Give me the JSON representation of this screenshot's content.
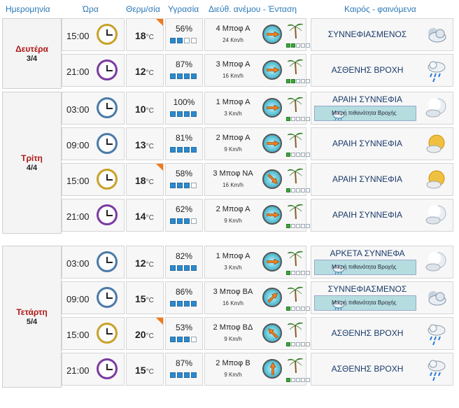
{
  "headers": {
    "date": "Ημερομηνία",
    "hour": "Ώρα",
    "temp": "Θερμ/σία",
    "humidity": "Υγρασία",
    "wind": "Διεύθ. ανέμου - Ένταση",
    "weather": "Καιρός - φαινόμενα"
  },
  "units": {
    "celsius": "°C"
  },
  "days": [
    {
      "name": "Δευτέρα",
      "date": "3/4",
      "rows": [
        {
          "time": "15:00",
          "clock": "pm1",
          "temp": "18",
          "temp_flag": true,
          "humidity": "56%",
          "hum_level": 2,
          "wind_dir": "4 Μποφ Α",
          "wind_speed": "24 Km/h",
          "wind_level": 2,
          "weather": "ΣΥΝΝΕΦΙΑΣΜΕΝΟΣ",
          "rain_note": "",
          "icon": "cloudy-icon"
        },
        {
          "time": "21:00",
          "clock": "pm2",
          "temp": "12",
          "temp_flag": false,
          "humidity": "87%",
          "hum_level": 4,
          "wind_dir": "3 Μποφ Α",
          "wind_speed": "16 Km/h",
          "wind_level": 2,
          "weather": "ΑΣΘΕΝΗΣ ΒΡΟΧΗ",
          "rain_note": "",
          "icon": "light-rain-icon"
        }
      ]
    },
    {
      "name": "Τρίτη",
      "date": "4/4",
      "rows": [
        {
          "time": "03:00",
          "clock": "am",
          "temp": "10",
          "temp_flag": false,
          "humidity": "100%",
          "hum_level": 4,
          "wind_dir": "1 Μποφ Α",
          "wind_speed": "3 Km/h",
          "wind_level": 1,
          "weather": "ΑΡΑΙΗ ΣΥΝΝΕΦΙΑ",
          "rain_note": "Μικρή πιθανότητα Βροχής",
          "icon": "moon-cloud-icon"
        },
        {
          "time": "09:00",
          "clock": "am",
          "temp": "13",
          "temp_flag": false,
          "humidity": "81%",
          "hum_level": 4,
          "wind_dir": "2 Μποφ Α",
          "wind_speed": "9 Km/h",
          "wind_level": 1,
          "weather": "ΑΡΑΙΗ ΣΥΝΝΕΦΙΑ",
          "rain_note": "",
          "icon": "sun-cloud-icon"
        },
        {
          "time": "15:00",
          "clock": "pm1",
          "temp": "18",
          "temp_flag": true,
          "humidity": "58%",
          "hum_level": 3,
          "wind_dir": "3 Μποφ ΝΑ",
          "wind_speed": "16 Km/h",
          "wind_level": 1,
          "weather": "ΑΡΑΙΗ ΣΥΝΝΕΦΙΑ",
          "rain_note": "",
          "icon": "sun-cloud-icon"
        },
        {
          "time": "21:00",
          "clock": "pm2",
          "temp": "14",
          "temp_flag": false,
          "humidity": "62%",
          "hum_level": 3,
          "wind_dir": "2 Μποφ Α",
          "wind_speed": "9 Km/h",
          "wind_level": 1,
          "weather": "ΑΡΑΙΗ ΣΥΝΝΕΦΙΑ",
          "rain_note": "",
          "icon": "moon-cloud-icon"
        }
      ]
    },
    {
      "name": "Τετάρτη",
      "date": "5/4",
      "rows": [
        {
          "time": "03:00",
          "clock": "am",
          "temp": "12",
          "temp_flag": false,
          "humidity": "82%",
          "hum_level": 4,
          "wind_dir": "1 Μποφ Α",
          "wind_speed": "3 Km/h",
          "wind_level": 1,
          "weather": "ΑΡΚΕΤΑ ΣΥΝΝΕΦΑ",
          "rain_note": "Μικρή πιθανότητα Βροχής",
          "icon": "moon-cloud-icon"
        },
        {
          "time": "09:00",
          "clock": "am",
          "temp": "15",
          "temp_flag": false,
          "humidity": "86%",
          "hum_level": 4,
          "wind_dir": "3 Μποφ ΒΑ",
          "wind_speed": "16 Km/h",
          "wind_level": 1,
          "weather": "ΣΥΝΝΕΦΙΑΣΜΕΝΟΣ",
          "rain_note": "Μικρή πιθανότητα Βροχής",
          "icon": "cloudy-icon"
        },
        {
          "time": "15:00",
          "clock": "pm1",
          "temp": "20",
          "temp_flag": true,
          "humidity": "53%",
          "hum_level": 3,
          "wind_dir": "2 Μποφ ΒΔ",
          "wind_speed": "9 Km/h",
          "wind_level": 1,
          "weather": "ΑΣΘΕΝΗΣ ΒΡΟΧΗ",
          "rain_note": "",
          "icon": "light-rain-icon"
        },
        {
          "time": "21:00",
          "clock": "pm2",
          "temp": "15",
          "temp_flag": false,
          "humidity": "87%",
          "hum_level": 4,
          "wind_dir": "2 Μποφ Β",
          "wind_speed": "9 Km/h",
          "wind_level": 1,
          "weather": "ΑΣΘΕΝΗΣ ΒΡΟΧΗ",
          "rain_note": "",
          "icon": "light-rain-icon"
        }
      ]
    }
  ]
}
